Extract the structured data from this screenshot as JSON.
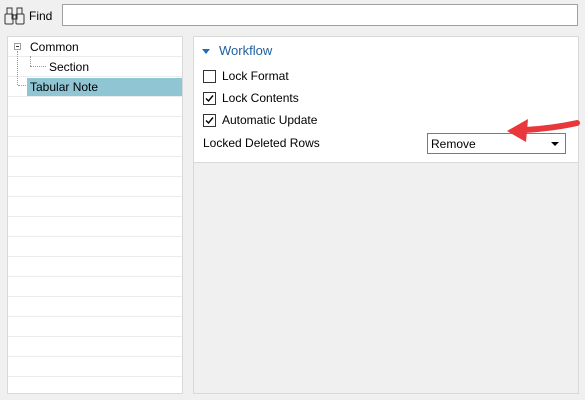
{
  "find": {
    "label": "Find",
    "value": "",
    "placeholder": ""
  },
  "tree": {
    "nodes": [
      {
        "label": "Common",
        "expanded": true,
        "selected": false
      },
      {
        "label": "Section",
        "selected": false
      },
      {
        "label": "Tabular Note",
        "selected": true
      }
    ]
  },
  "workflow": {
    "title": "Workflow",
    "options": [
      {
        "label": "Lock Format",
        "checked": false
      },
      {
        "label": "Lock Contents",
        "checked": true
      },
      {
        "label": "Automatic Update",
        "checked": true
      }
    ],
    "locked_deleted_rows": {
      "label": "Locked Deleted Rows",
      "value": "Remove"
    }
  },
  "colors": {
    "selection": "#90c6d4",
    "section_title": "#1f5f9f",
    "annotation_arrow": "#e8383b"
  },
  "icons": {
    "find": "binoculars-icon",
    "expander": "collapse-minus-icon",
    "section": "triangle-down-icon",
    "dropdown": "chevron-down-icon",
    "annotation": "red-arrow-icon"
  }
}
